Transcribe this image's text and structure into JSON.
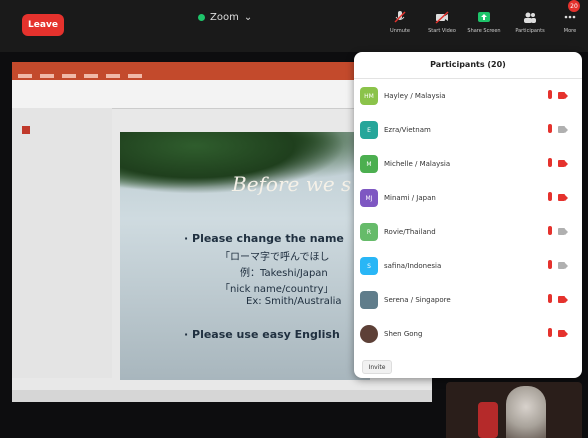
{
  "topbar": {
    "leave_label": "Leave",
    "zoom_title": "Zoom",
    "zoom_subtitle": "",
    "buttons": [
      {
        "name": "unmute",
        "label": "Unmute"
      },
      {
        "name": "start-video",
        "label": "Start Video"
      },
      {
        "name": "share-screen",
        "label": "Share Screen"
      },
      {
        "name": "participants",
        "label": "Participants"
      },
      {
        "name": "more",
        "label": "More"
      }
    ],
    "participants_badge": "20"
  },
  "slide": {
    "title": "Before we s",
    "lines": [
      "· Please change the name",
      "「ローマ字で呼んでほし",
      "例：Takeshi/Japan",
      "「nick name/country」",
      "Ex: Smith/Australia",
      "· Please use easy English"
    ]
  },
  "panel": {
    "title": "Participants (20)",
    "participants": [
      {
        "name": "Hayley / Malaysia",
        "initials": "HM",
        "color": "#8bc34a",
        "mic_muted": true,
        "cam_off": true
      },
      {
        "name": "Ezra/Vietnam",
        "initials": "E",
        "color": "#26a69a",
        "mic_muted": true,
        "cam_off": false
      },
      {
        "name": "Michelle / Malaysia",
        "initials": "M",
        "color": "#4caf50",
        "mic_muted": true,
        "cam_off": true
      },
      {
        "name": "Minami / Japan",
        "initials": "MJ",
        "color": "#7e57c2",
        "mic_muted": true,
        "cam_off": true
      },
      {
        "name": "Rovie/Thailand",
        "initials": "R",
        "color": "#66bb6a",
        "mic_muted": true,
        "cam_off": false
      },
      {
        "name": "safina/Indonesia",
        "initials": "S",
        "color": "#29b6f6",
        "mic_muted": true,
        "cam_off": false
      },
      {
        "name": "Serena / Singapore",
        "initials": "",
        "color": "#607d8b",
        "mic_muted": true,
        "cam_off": true
      },
      {
        "name": "Shen Gong",
        "initials": "",
        "color": "#5d4037",
        "mic_muted": true,
        "cam_off": true
      }
    ],
    "invite_label": "Invite"
  },
  "ppt": {
    "status_left": "",
    "status_sub": ""
  }
}
